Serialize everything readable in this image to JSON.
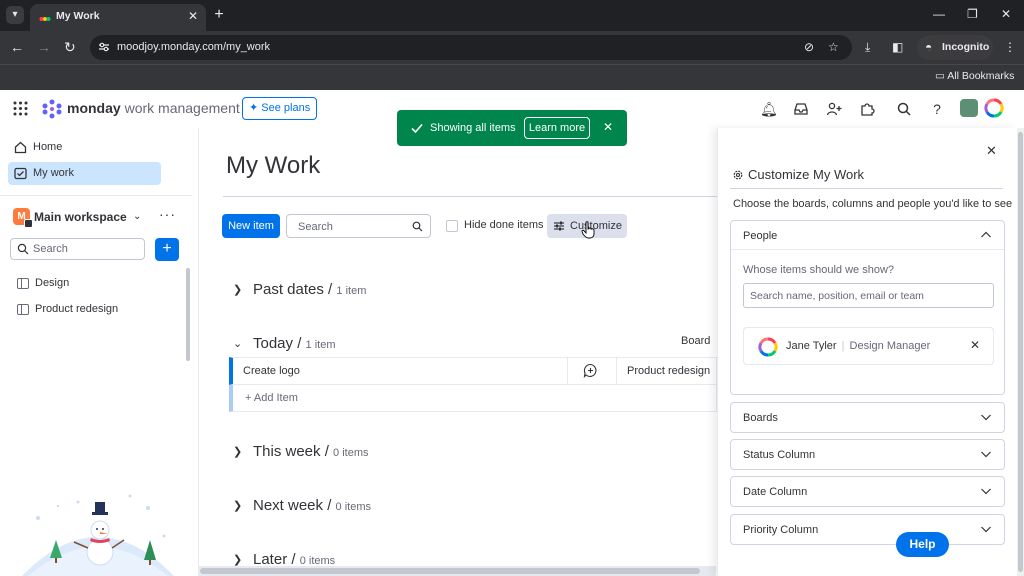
{
  "browser": {
    "tab_title": "My Work",
    "url": "moodjoy.monday.com/my_work",
    "incognito_label": "Incognito",
    "all_bookmarks": "All Bookmarks"
  },
  "header": {
    "brand_bold": "monday",
    "brand_rest": " work management",
    "see_plans": "See plans"
  },
  "sidebar": {
    "nav": [
      {
        "label": "Home",
        "icon": "home-icon"
      },
      {
        "label": "My work",
        "icon": "checkbox-icon",
        "active": true
      }
    ],
    "workspace": {
      "badge": "M",
      "name": "Main workspace"
    },
    "search_placeholder": "Search",
    "boards": [
      {
        "label": "Design"
      },
      {
        "label": "Product redesign"
      }
    ]
  },
  "main": {
    "title": "My Work",
    "new_item": "New item",
    "search_placeholder": "Search",
    "hide_done": "Hide done items",
    "customize": "Customize",
    "board_column": "Board",
    "groups": [
      {
        "title": "Past dates",
        "sep": " / ",
        "count": "1 item",
        "expanded": false
      },
      {
        "title": "Today",
        "sep": " / ",
        "count": "1 item",
        "expanded": true
      },
      {
        "title": "This week",
        "sep": " / ",
        "count": "0 items",
        "expanded": false
      },
      {
        "title": "Next week",
        "sep": " / ",
        "count": "0 items",
        "expanded": false
      },
      {
        "title": "Later",
        "sep": " / ",
        "count": "0 items",
        "expanded": false
      }
    ],
    "today_items": [
      {
        "name": "Create logo",
        "board": "Product redesign"
      }
    ],
    "add_item": "+ Add Item"
  },
  "toast": {
    "message": "Showing all items",
    "action": "Learn more"
  },
  "panel": {
    "title": "Customize My Work",
    "description": "Choose the boards, columns and people you'd like to see",
    "people": {
      "label": "People",
      "question": "Whose items should we show?",
      "placeholder": "Search name, position, email or team",
      "selected": {
        "name": "Jane Tyler",
        "sep": "|",
        "role": "Design Manager"
      }
    },
    "sections": [
      {
        "label": "Boards"
      },
      {
        "label": "Status Column"
      },
      {
        "label": "Date Column"
      },
      {
        "label": "Priority Column"
      }
    ],
    "help": "Help"
  },
  "colors": {
    "primary": "#0073ea",
    "toast_green": "#00854d",
    "active_nav": "#cce5ff",
    "workspace_badge": "#ff7b3d"
  }
}
